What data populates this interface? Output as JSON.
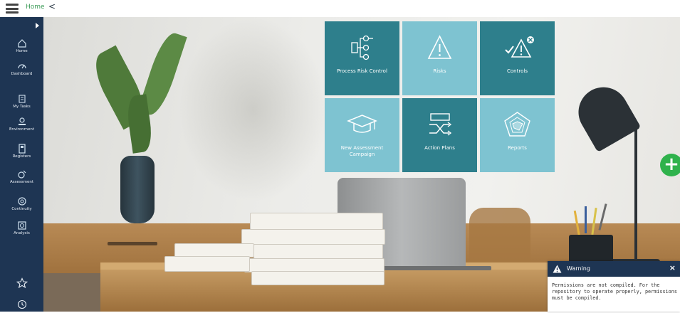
{
  "header": {
    "breadcrumb": "Home",
    "back_symbol": "<"
  },
  "sidebar": {
    "items": [
      {
        "label": "Home",
        "icon": "home-icon"
      },
      {
        "label": "Dashboard",
        "icon": "gauge-icon"
      },
      {
        "label": "My Tasks",
        "icon": "tasks-icon"
      },
      {
        "label": "Environment",
        "icon": "environment-icon"
      },
      {
        "label": "Registers",
        "icon": "registers-icon"
      },
      {
        "label": "Assessment",
        "icon": "assessment-icon"
      },
      {
        "label": "Continuity",
        "icon": "continuity-icon"
      },
      {
        "label": "Analysis",
        "icon": "analysis-icon"
      }
    ],
    "bottom_icons": [
      "star-icon",
      "history-icon"
    ]
  },
  "tiles": [
    {
      "label": "Process Risk Control",
      "icon": "process-flow-icon",
      "tone": "dark"
    },
    {
      "label": "Risks",
      "icon": "warning-triangle-icon",
      "tone": "light"
    },
    {
      "label": "Controls",
      "icon": "controls-icon",
      "tone": "dark"
    },
    {
      "label": "New Assessment Campaign",
      "icon": "graduation-cap-icon",
      "tone": "light"
    },
    {
      "label": "Action Plans",
      "icon": "shuffle-icon",
      "tone": "dark"
    },
    {
      "label": "Reports",
      "icon": "radar-chart-icon",
      "tone": "light"
    }
  ],
  "fab": {
    "label": "+"
  },
  "warning": {
    "title": "Warning",
    "close": "×",
    "message": "Permissions are not compiled. For the repository to operate properly, permissions must be compiled."
  },
  "colors": {
    "sidebar": "#1e3553",
    "tile_dark": "#2e7f8c",
    "tile_light": "#7ec3d1",
    "fab": "#2fb24c",
    "breadcrumb": "#3b9b57"
  }
}
